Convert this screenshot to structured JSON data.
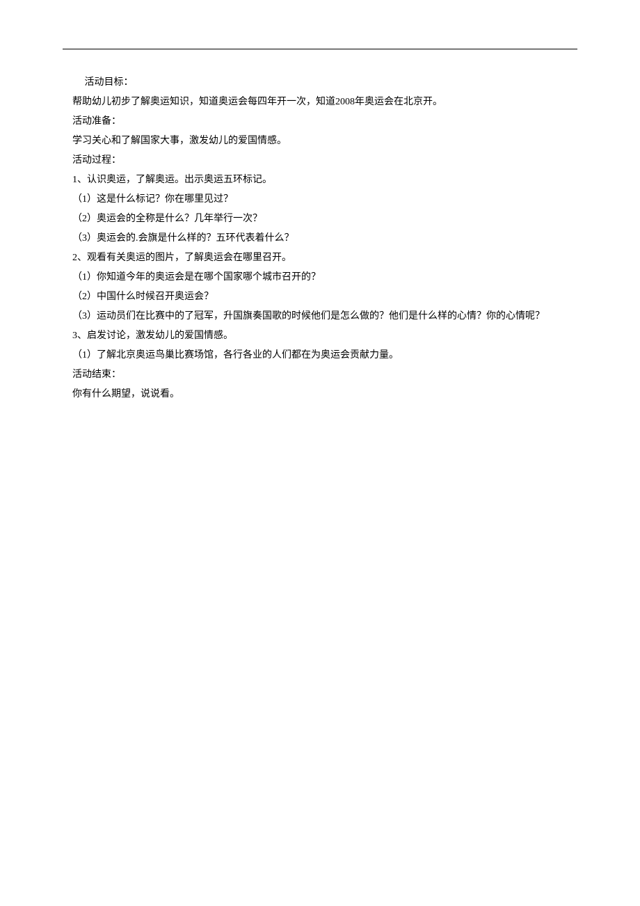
{
  "lines": [
    {
      "indent": 1,
      "text": " 活动目标："
    },
    {
      "indent": 0,
      "text": "帮助幼儿初步了解奥运知识，知道奥运会每四年开一次，知道2008年奥运会在北京开。"
    },
    {
      "indent": 0,
      "text": "活动准备："
    },
    {
      "indent": 0,
      "text": "学习关心和了解国家大事，激发幼儿的爱国情感。"
    },
    {
      "indent": 0,
      "text": "活动过程："
    },
    {
      "indent": 0,
      "text": "1、认识奥运，了解奥运。出示奥运五环标记。"
    },
    {
      "indent": 0,
      "text": "（1）这是什么标记？你在哪里见过？"
    },
    {
      "indent": 0,
      "text": "（2）奥运会的全称是什么？几年举行一次？"
    },
    {
      "indent": 0,
      "text": "（3）奥运会的.会旗是什么样的？五环代表着什么？"
    },
    {
      "indent": 0,
      "text": "2、观看有关奥运的图片，了解奥运会在哪里召开。"
    },
    {
      "indent": 0,
      "text": "（1）你知道今年的奥运会是在哪个国家哪个城市召开的？"
    },
    {
      "indent": 0,
      "text": "（2）中国什么时候召开奥运会？"
    },
    {
      "indent": 0,
      "text": "（3）运动员们在比赛中的了冠军，升国旗奏国歌的时候他们是怎么做的？他们是什么样的心情？你的心情呢？"
    },
    {
      "indent": 0,
      "text": "3、启发讨论，激发幼儿的爱国情感。"
    },
    {
      "indent": 0,
      "text": "（1）了解北京奥运鸟巢比赛场馆，各行各业的人们都在为奥运会贡献力量。"
    },
    {
      "indent": 0,
      "text": "活动结束："
    },
    {
      "indent": 0,
      "text": "你有什么期望，说说看。"
    }
  ]
}
